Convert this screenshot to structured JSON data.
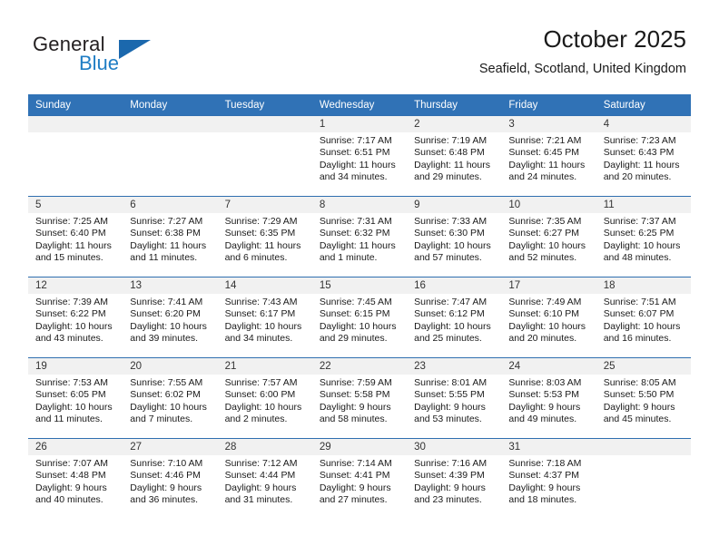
{
  "brand": {
    "name_part1": "General",
    "name_part2": "Blue",
    "logo_icon": "triangle-logo-icon"
  },
  "header": {
    "title": "October 2025",
    "subtitle": "Seafield, Scotland, United Kingdom"
  },
  "calendar": {
    "accent_color": "#3072b6",
    "daynum_strip_color": "#f1f1f1",
    "weekday_headers": [
      "Sunday",
      "Monday",
      "Tuesday",
      "Wednesday",
      "Thursday",
      "Friday",
      "Saturday"
    ],
    "weeks": [
      [
        {
          "day": "",
          "sunrise": "",
          "sunset": "",
          "daylight_line1": "",
          "daylight_line2": ""
        },
        {
          "day": "",
          "sunrise": "",
          "sunset": "",
          "daylight_line1": "",
          "daylight_line2": ""
        },
        {
          "day": "",
          "sunrise": "",
          "sunset": "",
          "daylight_line1": "",
          "daylight_line2": ""
        },
        {
          "day": "1",
          "sunrise": "Sunrise: 7:17 AM",
          "sunset": "Sunset: 6:51 PM",
          "daylight_line1": "Daylight: 11 hours",
          "daylight_line2": "and 34 minutes."
        },
        {
          "day": "2",
          "sunrise": "Sunrise: 7:19 AM",
          "sunset": "Sunset: 6:48 PM",
          "daylight_line1": "Daylight: 11 hours",
          "daylight_line2": "and 29 minutes."
        },
        {
          "day": "3",
          "sunrise": "Sunrise: 7:21 AM",
          "sunset": "Sunset: 6:45 PM",
          "daylight_line1": "Daylight: 11 hours",
          "daylight_line2": "and 24 minutes."
        },
        {
          "day": "4",
          "sunrise": "Sunrise: 7:23 AM",
          "sunset": "Sunset: 6:43 PM",
          "daylight_line1": "Daylight: 11 hours",
          "daylight_line2": "and 20 minutes."
        }
      ],
      [
        {
          "day": "5",
          "sunrise": "Sunrise: 7:25 AM",
          "sunset": "Sunset: 6:40 PM",
          "daylight_line1": "Daylight: 11 hours",
          "daylight_line2": "and 15 minutes."
        },
        {
          "day": "6",
          "sunrise": "Sunrise: 7:27 AM",
          "sunset": "Sunset: 6:38 PM",
          "daylight_line1": "Daylight: 11 hours",
          "daylight_line2": "and 11 minutes."
        },
        {
          "day": "7",
          "sunrise": "Sunrise: 7:29 AM",
          "sunset": "Sunset: 6:35 PM",
          "daylight_line1": "Daylight: 11 hours",
          "daylight_line2": "and 6 minutes."
        },
        {
          "day": "8",
          "sunrise": "Sunrise: 7:31 AM",
          "sunset": "Sunset: 6:32 PM",
          "daylight_line1": "Daylight: 11 hours",
          "daylight_line2": "and 1 minute."
        },
        {
          "day": "9",
          "sunrise": "Sunrise: 7:33 AM",
          "sunset": "Sunset: 6:30 PM",
          "daylight_line1": "Daylight: 10 hours",
          "daylight_line2": "and 57 minutes."
        },
        {
          "day": "10",
          "sunrise": "Sunrise: 7:35 AM",
          "sunset": "Sunset: 6:27 PM",
          "daylight_line1": "Daylight: 10 hours",
          "daylight_line2": "and 52 minutes."
        },
        {
          "day": "11",
          "sunrise": "Sunrise: 7:37 AM",
          "sunset": "Sunset: 6:25 PM",
          "daylight_line1": "Daylight: 10 hours",
          "daylight_line2": "and 48 minutes."
        }
      ],
      [
        {
          "day": "12",
          "sunrise": "Sunrise: 7:39 AM",
          "sunset": "Sunset: 6:22 PM",
          "daylight_line1": "Daylight: 10 hours",
          "daylight_line2": "and 43 minutes."
        },
        {
          "day": "13",
          "sunrise": "Sunrise: 7:41 AM",
          "sunset": "Sunset: 6:20 PM",
          "daylight_line1": "Daylight: 10 hours",
          "daylight_line2": "and 39 minutes."
        },
        {
          "day": "14",
          "sunrise": "Sunrise: 7:43 AM",
          "sunset": "Sunset: 6:17 PM",
          "daylight_line1": "Daylight: 10 hours",
          "daylight_line2": "and 34 minutes."
        },
        {
          "day": "15",
          "sunrise": "Sunrise: 7:45 AM",
          "sunset": "Sunset: 6:15 PM",
          "daylight_line1": "Daylight: 10 hours",
          "daylight_line2": "and 29 minutes."
        },
        {
          "day": "16",
          "sunrise": "Sunrise: 7:47 AM",
          "sunset": "Sunset: 6:12 PM",
          "daylight_line1": "Daylight: 10 hours",
          "daylight_line2": "and 25 minutes."
        },
        {
          "day": "17",
          "sunrise": "Sunrise: 7:49 AM",
          "sunset": "Sunset: 6:10 PM",
          "daylight_line1": "Daylight: 10 hours",
          "daylight_line2": "and 20 minutes."
        },
        {
          "day": "18",
          "sunrise": "Sunrise: 7:51 AM",
          "sunset": "Sunset: 6:07 PM",
          "daylight_line1": "Daylight: 10 hours",
          "daylight_line2": "and 16 minutes."
        }
      ],
      [
        {
          "day": "19",
          "sunrise": "Sunrise: 7:53 AM",
          "sunset": "Sunset: 6:05 PM",
          "daylight_line1": "Daylight: 10 hours",
          "daylight_line2": "and 11 minutes."
        },
        {
          "day": "20",
          "sunrise": "Sunrise: 7:55 AM",
          "sunset": "Sunset: 6:02 PM",
          "daylight_line1": "Daylight: 10 hours",
          "daylight_line2": "and 7 minutes."
        },
        {
          "day": "21",
          "sunrise": "Sunrise: 7:57 AM",
          "sunset": "Sunset: 6:00 PM",
          "daylight_line1": "Daylight: 10 hours",
          "daylight_line2": "and 2 minutes."
        },
        {
          "day": "22",
          "sunrise": "Sunrise: 7:59 AM",
          "sunset": "Sunset: 5:58 PM",
          "daylight_line1": "Daylight: 9 hours",
          "daylight_line2": "and 58 minutes."
        },
        {
          "day": "23",
          "sunrise": "Sunrise: 8:01 AM",
          "sunset": "Sunset: 5:55 PM",
          "daylight_line1": "Daylight: 9 hours",
          "daylight_line2": "and 53 minutes."
        },
        {
          "day": "24",
          "sunrise": "Sunrise: 8:03 AM",
          "sunset": "Sunset: 5:53 PM",
          "daylight_line1": "Daylight: 9 hours",
          "daylight_line2": "and 49 minutes."
        },
        {
          "day": "25",
          "sunrise": "Sunrise: 8:05 AM",
          "sunset": "Sunset: 5:50 PM",
          "daylight_line1": "Daylight: 9 hours",
          "daylight_line2": "and 45 minutes."
        }
      ],
      [
        {
          "day": "26",
          "sunrise": "Sunrise: 7:07 AM",
          "sunset": "Sunset: 4:48 PM",
          "daylight_line1": "Daylight: 9 hours",
          "daylight_line2": "and 40 minutes."
        },
        {
          "day": "27",
          "sunrise": "Sunrise: 7:10 AM",
          "sunset": "Sunset: 4:46 PM",
          "daylight_line1": "Daylight: 9 hours",
          "daylight_line2": "and 36 minutes."
        },
        {
          "day": "28",
          "sunrise": "Sunrise: 7:12 AM",
          "sunset": "Sunset: 4:44 PM",
          "daylight_line1": "Daylight: 9 hours",
          "daylight_line2": "and 31 minutes."
        },
        {
          "day": "29",
          "sunrise": "Sunrise: 7:14 AM",
          "sunset": "Sunset: 4:41 PM",
          "daylight_line1": "Daylight: 9 hours",
          "daylight_line2": "and 27 minutes."
        },
        {
          "day": "30",
          "sunrise": "Sunrise: 7:16 AM",
          "sunset": "Sunset: 4:39 PM",
          "daylight_line1": "Daylight: 9 hours",
          "daylight_line2": "and 23 minutes."
        },
        {
          "day": "31",
          "sunrise": "Sunrise: 7:18 AM",
          "sunset": "Sunset: 4:37 PM",
          "daylight_line1": "Daylight: 9 hours",
          "daylight_line2": "and 18 minutes."
        },
        {
          "day": "",
          "sunrise": "",
          "sunset": "",
          "daylight_line1": "",
          "daylight_line2": ""
        }
      ]
    ]
  }
}
